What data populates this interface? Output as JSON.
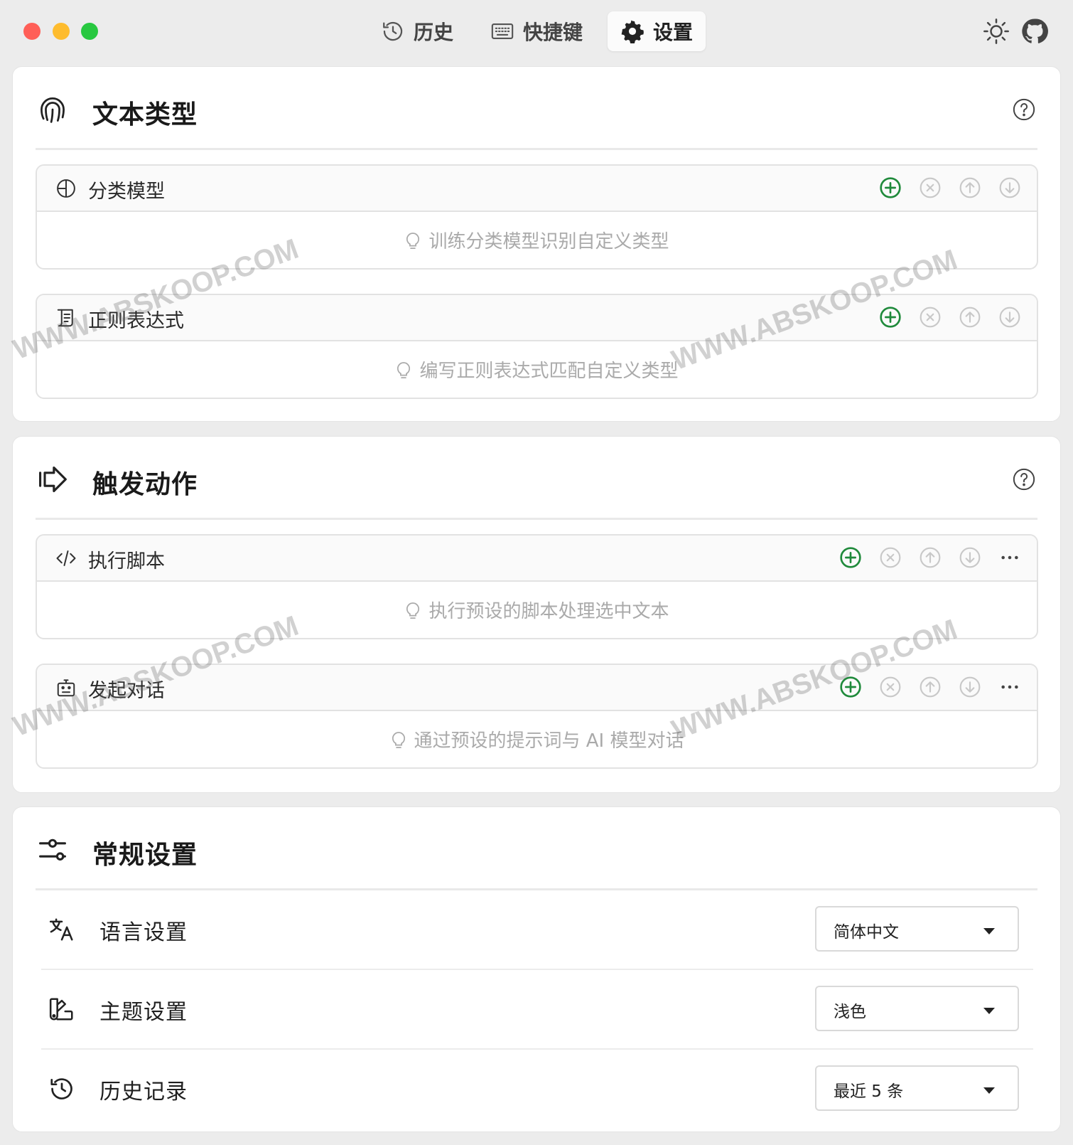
{
  "toolbar": {
    "tabs": [
      {
        "label": "历史",
        "icon": "history-icon"
      },
      {
        "label": "快捷键",
        "icon": "keyboard-icon"
      },
      {
        "label": "设置",
        "icon": "gear-icon",
        "active": true
      }
    ],
    "right_icons": [
      "sun-icon",
      "github-icon"
    ]
  },
  "text_types": {
    "title": "文本类型",
    "icon": "fingerprint-icon",
    "panels": [
      {
        "title": "分类模型",
        "icon": "model-icon",
        "hint": "训练分类模型识别自定义类型"
      },
      {
        "title": "正则表达式",
        "icon": "script-icon",
        "hint": "编写正则表达式匹配自定义类型"
      }
    ]
  },
  "actions": {
    "title": "触发动作",
    "icon": "trigger-arrow-icon",
    "panels": [
      {
        "title": "执行脚本",
        "icon": "code-icon",
        "hint": "执行预设的脚本处理选中文本"
      },
      {
        "title": "发起对话",
        "icon": "bot-icon",
        "hint": "通过预设的提示词与 AI 模型对话"
      }
    ]
  },
  "general": {
    "title": "常规设置",
    "icon": "sliders-icon",
    "rows": [
      {
        "label": "语言设置",
        "icon": "translate-icon",
        "value": "简体中文"
      },
      {
        "label": "主题设置",
        "icon": "theme-icon",
        "value": "浅色"
      },
      {
        "label": "历史记录",
        "icon": "history-icon",
        "value": "最近 5 条"
      }
    ]
  },
  "watermark": "WWW.ABSKOOP.COM",
  "colors": {
    "accent_green": "#1f8a3b",
    "disabled_gray": "#c8c8c8"
  }
}
